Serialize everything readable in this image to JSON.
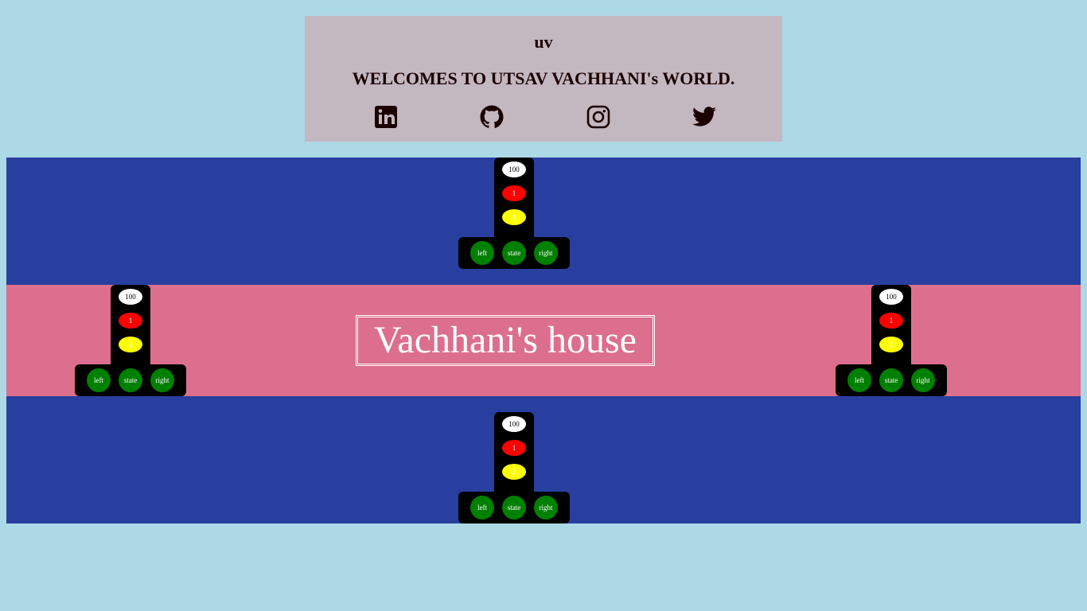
{
  "header": {
    "logo": "uv",
    "welcome": "WELCOMES TO UTSAV VACHHANI's WORLD.",
    "social": [
      {
        "icon": "linkedin-icon"
      },
      {
        "icon": "github-icon"
      },
      {
        "icon": "instagram-icon"
      },
      {
        "icon": "twitter-icon"
      }
    ]
  },
  "house": {
    "title": "Vachhani's house"
  },
  "colors": {
    "background": "#add8e6",
    "header": "#c3b7c0",
    "road": "#283fa0",
    "house_band": "#dc6f8d",
    "green": "#008000",
    "red": "#ff0000",
    "yellow": "#ffff00"
  },
  "traffic_lights": {
    "top": {
      "counter": "100",
      "red": "1",
      "yellow": "2",
      "left": "left",
      "state": "state",
      "right": "right"
    },
    "left": {
      "counter": "100",
      "red": "1",
      "yellow": "2",
      "left": "left",
      "state": "state",
      "right": "right"
    },
    "right": {
      "counter": "100",
      "red": "1",
      "yellow": "2",
      "left": "left",
      "state": "state",
      "right": "right"
    },
    "bottom": {
      "counter": "100",
      "red": "1",
      "yellow": "2",
      "left": "left",
      "state": "state",
      "right": "right"
    }
  }
}
